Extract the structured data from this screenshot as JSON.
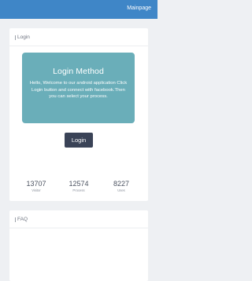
{
  "topbar": {
    "nav_label": "Mainpage"
  },
  "login_section": {
    "title": "Login",
    "hero_title": "Login Method",
    "hero_text": "Hello, Welcome to our android application Click Login button and connect with facebook.Then you can select your process.",
    "button_label": "Login",
    "stats": [
      {
        "value": "13707",
        "label": "Visitor"
      },
      {
        "value": "12574",
        "label": "Process"
      },
      {
        "value": "8227",
        "label": "Uses"
      }
    ]
  },
  "faq_section": {
    "title": "FAQ"
  },
  "colors": {
    "topbar": "#3f86c7",
    "hero": "#6aaeb9",
    "button": "#3a4357",
    "background": "#eef0f3"
  }
}
